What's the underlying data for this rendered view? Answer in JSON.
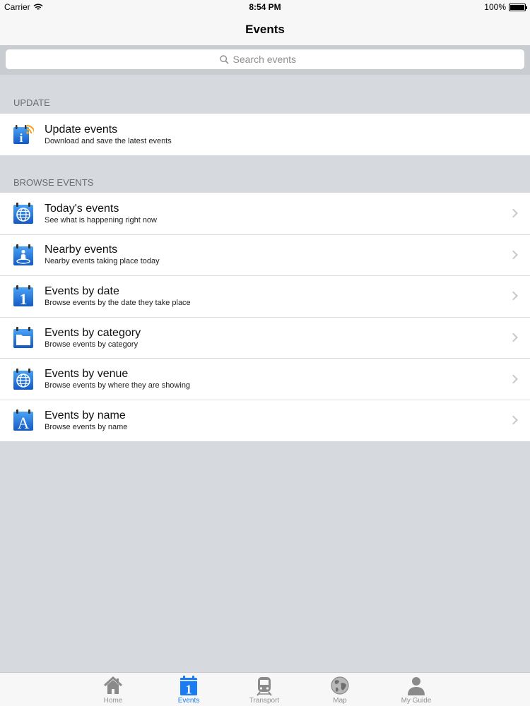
{
  "status_bar": {
    "carrier": "Carrier",
    "time": "8:54 PM",
    "battery": "100%",
    "battery_level": 1.0
  },
  "nav": {
    "title": "Events"
  },
  "search": {
    "placeholder": "Search events",
    "icon": "search-icon"
  },
  "sections": {
    "update": {
      "header": "UPDATE",
      "items": [
        {
          "title": "Update events",
          "subtitle": "Download and save the latest events",
          "icon": "info-rss-icon"
        }
      ]
    },
    "browse": {
      "header": "BROWSE EVENTS",
      "items": [
        {
          "title": "Today's events",
          "subtitle": "See what is happening right now",
          "icon": "globe-calendar-icon"
        },
        {
          "title": "Nearby events",
          "subtitle": "Nearby events taking place today",
          "icon": "person-location-icon"
        },
        {
          "title": "Events by date",
          "subtitle": "Browse events by the date they take place",
          "icon": "calendar-date-icon"
        },
        {
          "title": "Events by category",
          "subtitle": "Browse events by category",
          "icon": "folder-icon"
        },
        {
          "title": "Events by venue",
          "subtitle": "Browse events by where they are showing",
          "icon": "globe-calendar-icon"
        },
        {
          "title": "Events by name",
          "subtitle": "Browse events by name",
          "icon": "letter-a-icon"
        }
      ]
    }
  },
  "tab_bar": {
    "active": "Events",
    "tabs": [
      {
        "label": "Home",
        "icon": "home-icon"
      },
      {
        "label": "Events",
        "icon": "calendar-icon"
      },
      {
        "label": "Transport",
        "icon": "train-icon"
      },
      {
        "label": "Map",
        "icon": "globe-icon"
      },
      {
        "label": "My Guide",
        "icon": "person-icon"
      }
    ]
  },
  "colors": {
    "accent": "#1b7cf2",
    "icon_blue": "#1f6fd6",
    "rss_orange": "#f5a623",
    "background": "#d6d9de"
  }
}
